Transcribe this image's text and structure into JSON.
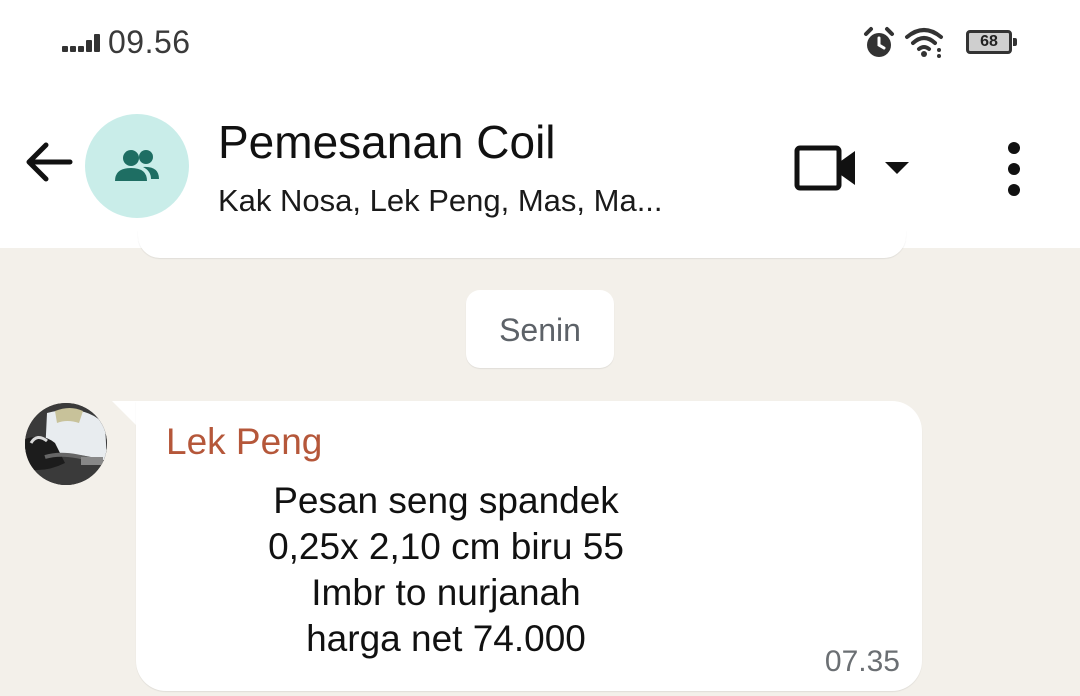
{
  "status_bar": {
    "time": "09.56",
    "battery": "68"
  },
  "header": {
    "title": "Pemesanan Coil",
    "subtitle": "Kak Nosa, Lek Peng, Mas, Ma..."
  },
  "chat": {
    "date_chip": "Senin",
    "message": {
      "sender": "Lek Peng",
      "lines": [
        "Pesan seng spandek",
        "0,25x 2,10 cm biru 55",
        "Imbr to nurjanah",
        "harga net 74.000"
      ],
      "time": "07.35"
    }
  },
  "colors": {
    "chat_background": "#f3f0ea",
    "group_avatar_bg": "#c9ede9",
    "group_icon": "#1e6e63",
    "sender_name": "#b5573a"
  }
}
